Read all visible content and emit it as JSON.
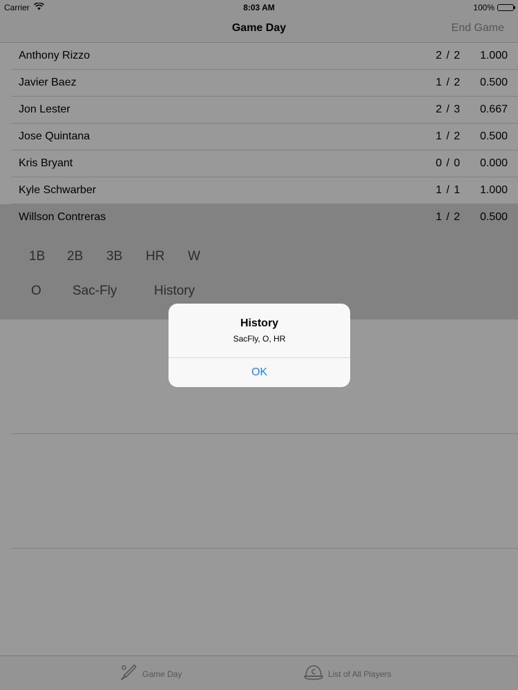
{
  "status_bar": {
    "carrier": "Carrier",
    "time": "8:03 AM",
    "battery": "100%"
  },
  "nav": {
    "title": "Game Day",
    "end_game_label": "End Game"
  },
  "players": [
    {
      "name": "Anthony Rizzo",
      "hits": "2 / 2",
      "avg": "1.000"
    },
    {
      "name": "Javier Baez",
      "hits": "1 / 2",
      "avg": "0.500"
    },
    {
      "name": "Jon Lester",
      "hits": "2 / 3",
      "avg": "0.667"
    },
    {
      "name": "Jose Quintana",
      "hits": "1 / 2",
      "avg": "0.500"
    },
    {
      "name": "Kris Bryant",
      "hits": "0 / 0",
      "avg": "0.000"
    },
    {
      "name": "Kyle Schwarber",
      "hits": "1 / 1",
      "avg": "1.000"
    },
    {
      "name": "Willson Contreras",
      "hits": "1 / 2",
      "avg": "0.500"
    }
  ],
  "actions": {
    "single": "1B",
    "double": "2B",
    "triple": "3B",
    "homerun": "HR",
    "walk": "W",
    "out": "O",
    "sac_fly": "Sac-Fly",
    "history": "History"
  },
  "alert": {
    "title": "History",
    "message": "SacFly, O, HR",
    "ok_label": "OK"
  },
  "tabs": [
    {
      "label": "Game Day",
      "icon": "baseball-bat-icon"
    },
    {
      "label": "List of All Players",
      "icon": "baseball-cap-icon"
    }
  ],
  "colors": {
    "accent": "#1a82fb",
    "selected_row": "#d9d9d9",
    "inactive": "#8e8e93"
  }
}
